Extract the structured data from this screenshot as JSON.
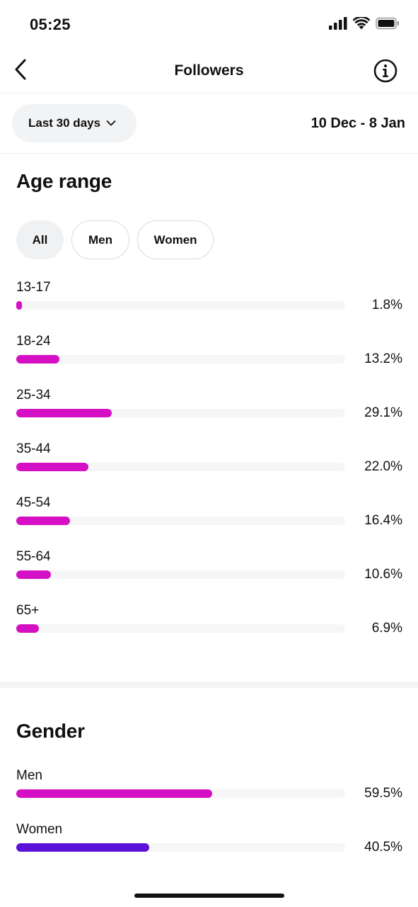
{
  "status_bar": {
    "time": "05:25"
  },
  "header": {
    "title": "Followers"
  },
  "filter": {
    "range_label": "Last 30 days",
    "date_range": "10 Dec - 8 Jan"
  },
  "age_range": {
    "title": "Age range",
    "chips": [
      "All",
      "Men",
      "Women"
    ],
    "selected_chip": "All",
    "rows": [
      {
        "label": "13-17",
        "percent_text": "1.8%",
        "percent": 1.8
      },
      {
        "label": "18-24",
        "percent_text": "13.2%",
        "percent": 13.2
      },
      {
        "label": "25-34",
        "percent_text": "29.1%",
        "percent": 29.1
      },
      {
        "label": "35-44",
        "percent_text": "22.0%",
        "percent": 22.0
      },
      {
        "label": "45-54",
        "percent_text": "16.4%",
        "percent": 16.4
      },
      {
        "label": "55-64",
        "percent_text": "10.6%",
        "percent": 10.6
      },
      {
        "label": "65+",
        "percent_text": "6.9%",
        "percent": 6.9
      }
    ]
  },
  "gender": {
    "title": "Gender",
    "rows": [
      {
        "label": "Men",
        "percent_text": "59.5%",
        "percent": 59.5
      },
      {
        "label": "Women",
        "percent_text": "40.5%",
        "percent": 40.5
      }
    ]
  },
  "colors": {
    "age_bar": "#d50fc4",
    "men_bar": "#d50fc4",
    "women_bar": "#5b12d9",
    "track": "#f6f6f7"
  },
  "icons": {
    "back": "chevron-left-icon",
    "info": "info-circle-icon",
    "dropdown": "chevron-down-icon",
    "signal": "cellular-signal-icon",
    "wifi": "wifi-icon",
    "battery": "battery-icon"
  }
}
